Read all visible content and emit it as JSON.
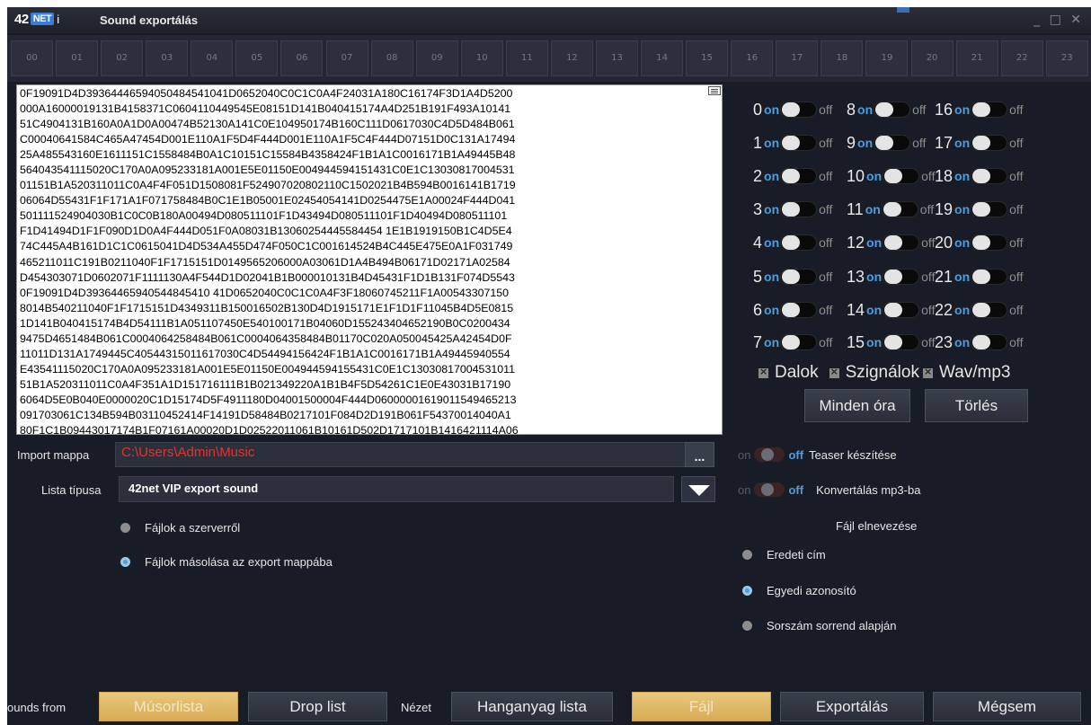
{
  "window": {
    "logo_text": "42",
    "logo_net": "NET",
    "logo_i": "i",
    "title": "Sound exportálás",
    "controls": "_ □ ✕"
  },
  "hours": [
    "00",
    "01",
    "02",
    "03",
    "04",
    "05",
    "06",
    "07",
    "08",
    "09",
    "10",
    "11",
    "12",
    "13",
    "14",
    "15",
    "16",
    "17",
    "18",
    "19",
    "20",
    "21",
    "22",
    "23"
  ],
  "hex_lines": [
    "0F19091D4D39364446594050484541041D0652040C0C1C0A4F24031A180C16174F3D1A4D5200",
    "000A16000019131B4158371C0604110449545E08151D141B040415174A4D251B191F493A10141",
    "51C4904131B160A0A1D0A00474B52130A141C0E104950174B160C111D0617030C4D5D484B061",
    "C00040641584C465A47454D001E110A1F5D4F444D001E110A1F5C4F444D07151D0C131A17494",
    "25A485543160E1611151C1558484B0A1C10151C15584B4358424F1B1A1C0016171B1A49445B48",
    "564043541115020C170A0A095233181A001E5E01150E004944594151431C0E1C13030817004531",
    "01151B1A520311011C0A4F4F051D1508081F524907020802110C1502021B4B594B0016141B1719",
    "06064D55431F1F171A1F071758484B0C1E1B05001E02454054141D0254475E1A00024F444D041",
    "501111524904030B1C0C0B180A00494D080511101F1D43494D080511101F1D40494D080511101",
    "F1D41494D1F1F090D1D0A4F444D051F0A08031B13060254445584454 1E1B1919150B1C4D5E4",
    "74C445A4B161D1C1C0615041D4D534A455D474F050C1C001614524B4C445E475E0A1F031749",
    "465211011C191B0211040F1F1715151D0149565206000A03061D1A4B494B06171D02171A02584",
    "D454303071D0602071F1111130A4F544D1D02041B1B000010131B4D45431F1D1B131F074D5543",
    "0F19091D4D39364465940544845410 41D0652040C0C1C0A4F3F18060745211F1A00543307150",
    "8014B540211040F1F1715151D4349311B150016502B130D4D1915171E1F1D1F11045B4D5E0815",
    "1D141B040415174B4D54111B1A051107450E540100171B04060D155243404652190B0C0200434",
    "9475D4651484B061C0004064258484B061C0004064358484B01170C020A050045425A42454D0F",
    "11011D131A1749445C40544315011617030C4D54494156424F1B1A1C0016171B1A49445940554",
    "E43541115020C170A0A095233181A001E5E01150E004944594155431C0E1C13030817004531011",
    "51B1A520311011C0A4F351A1D151716111B1B021349220A1B1B4F5D54261C1E0E43031B17190",
    "6064D5E0B040E0000020C1D15174D5F4911180D04001500004F444D06000001619011549465213",
    "091703061C134B594B03110452414F14191D58484B0217101F084D2D191B061F54370014040A1",
    "80F1C1B09443017174B1F07161A00020D1D02522011061B10161D502D1717101B1416421114A06"
  ],
  "toggles": {
    "on_label": "on",
    "off_label": "off",
    "hours": [
      "0",
      "1",
      "2",
      "3",
      "4",
      "5",
      "6",
      "7",
      "8",
      "9",
      "10",
      "11",
      "12",
      "13",
      "14",
      "15",
      "16",
      "17",
      "18",
      "19",
      "20",
      "21",
      "22",
      "23"
    ]
  },
  "categories": {
    "dalok": "Dalok",
    "szignalok": "Szignálok",
    "wav": "Wav/mp3"
  },
  "buttons": {
    "minden_ora": "Minden óra",
    "torles": "Törlés",
    "browse": "...",
    "musorlista": "Músorlista",
    "drop_list": "Drop list",
    "hanganyag": "Hanganyag lista",
    "fajl": "Fájl",
    "exportalas": "Exportálás",
    "megsem": "Mégsem"
  },
  "import": {
    "label": "Import mappa",
    "value": "C:\\Users\\Admin\\Music"
  },
  "lista": {
    "label": "Lista típusa",
    "value": "42net VIP export sound"
  },
  "source_radios": {
    "from_server": "Fájlok a szerverről",
    "copy_export": "Fájlok másolása az export mappába"
  },
  "teaser": {
    "on": "on",
    "off": "off",
    "label": "Teaser készítése"
  },
  "convert": {
    "on": "on",
    "off": "off",
    "label": "Konvertálás mp3-ba"
  },
  "naming": {
    "header": "Fájl elnevezése",
    "original": "Eredeti cím",
    "unique": "Egyedi azonosító",
    "order": "Sorszám sorrend alapján"
  },
  "footer": {
    "sounds_from": "ounds from",
    "nezet": "Nézet"
  },
  "colors": {
    "background": "#181c26",
    "accent_blue": "#4f9ddd",
    "gold_button": "#d7ab55",
    "path_red": "#e6332a"
  }
}
